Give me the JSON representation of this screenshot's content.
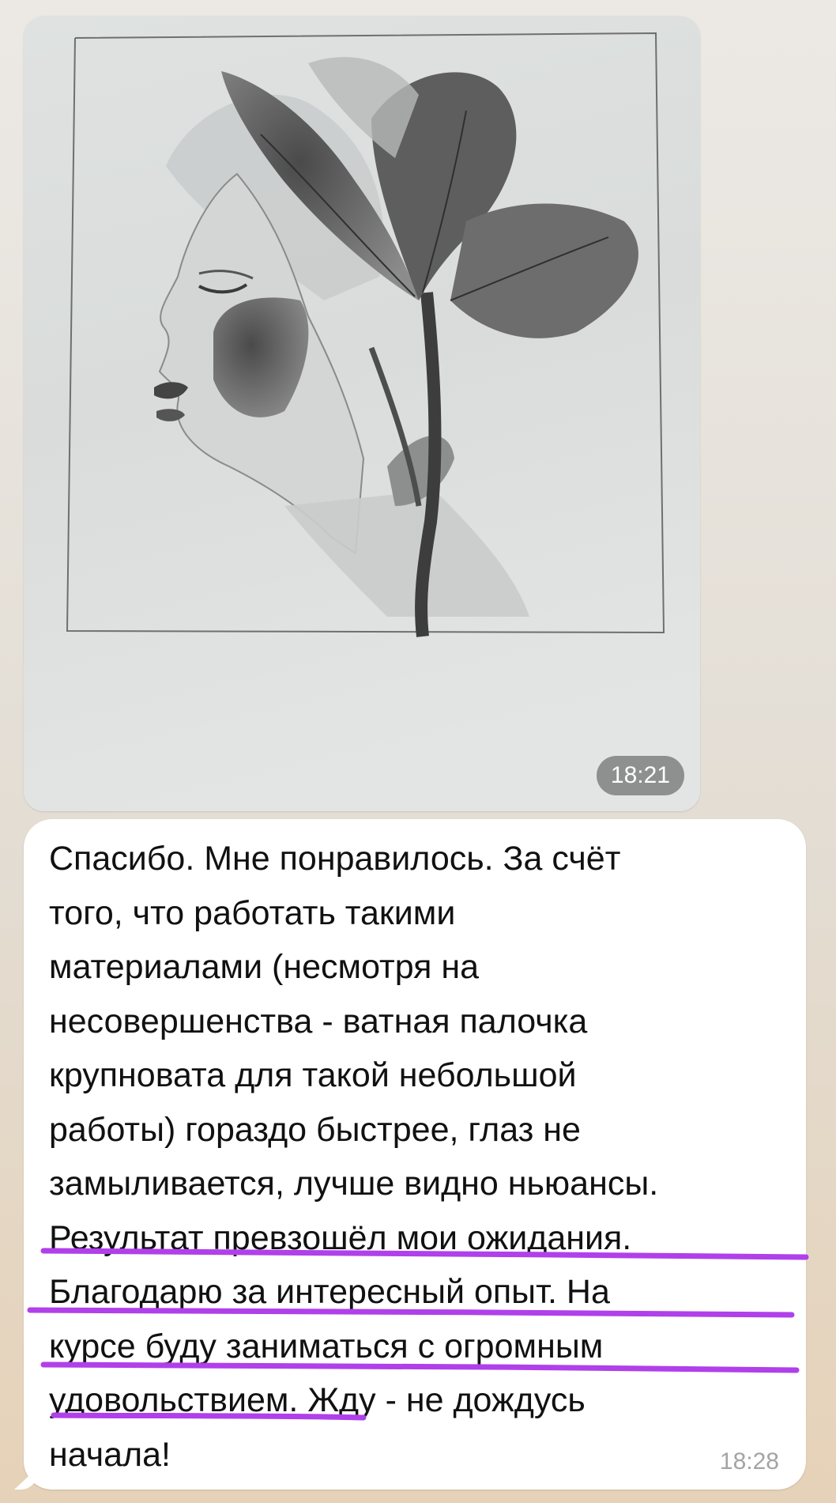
{
  "photo_message": {
    "time": "18:21",
    "image_description_icon": "pencil-drawing-photo"
  },
  "text_message": {
    "lines": [
      "Спасибо. Мне понравилось. За счёт",
      "того, что работать такими",
      "материалами (несмотря на",
      "несовершенства - ватная палочка",
      "крупновата для такой небольшой",
      "работы) гораздо быстрее, глаз не",
      "замыливается, лучше видно ньюансы.",
      "Результат превзошёл мои ожидания.",
      "Благодарю за интересный опыт. На",
      "курсе буду заниматься с огромным",
      "удовольствием. Жду - не дождусь",
      "начала!"
    ],
    "time": "18:28"
  },
  "colors": {
    "highlight": "#b040ea",
    "bubble": "#ffffff",
    "time_badge": "#5a5a5a"
  }
}
